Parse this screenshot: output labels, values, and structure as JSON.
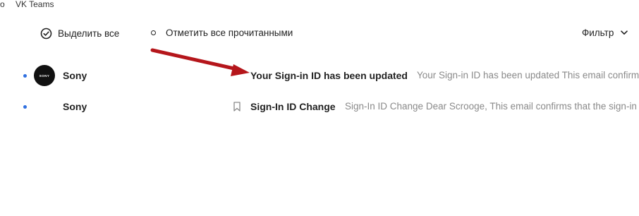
{
  "topbar": {
    "lead_char": "o",
    "app_name": "VK Teams"
  },
  "toolbar": {
    "select_all_label": "Выделить все",
    "mark_read_label": "Отметить все прочитанными",
    "filter_label": "Фильтр"
  },
  "messages": [
    {
      "sender": "Sony",
      "avatar_text": "SONY",
      "subject": "Your Sign-in ID has been updated",
      "preview": "Your Sign-in ID has been updated This email confirms",
      "unread": true
    },
    {
      "sender": "Sony",
      "subject": "Sign-In ID Change",
      "preview": "Sign-In ID Change Dear Scrooge, This email confirms that the sign-in",
      "unread": true
    }
  ],
  "colors": {
    "unread_dot": "#2f6fe0",
    "annotation_arrow": "#b5161b",
    "preview_text": "#8a8a8a"
  }
}
